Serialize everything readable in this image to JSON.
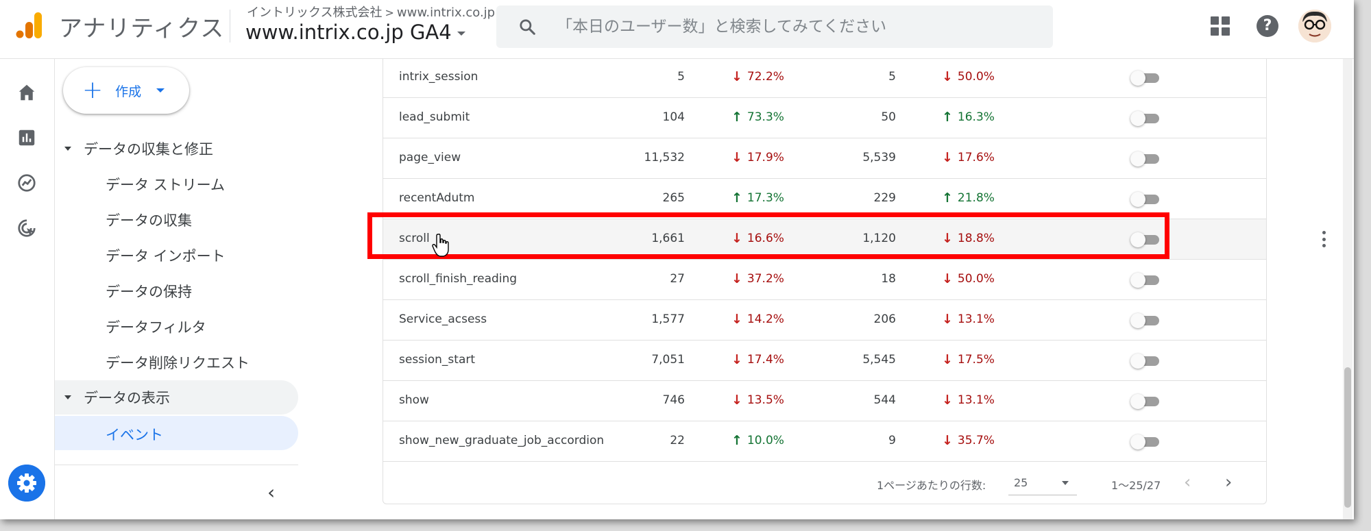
{
  "header": {
    "app_name": "アナリティクス",
    "account_name": "イントリックス株式会社",
    "account_url": "www.intrix.co.jp",
    "property_name": "www.intrix.co.jp GA4",
    "search_placeholder": "「本日のユーザー数」と検索してみてください",
    "logo_colors": [
      "#f9ab00",
      "#e37400"
    ],
    "icons": [
      "analytics-logo-icon",
      "search-icon",
      "apps-grid-icon",
      "help-icon",
      "avatar"
    ]
  },
  "rail": {
    "icons": [
      "home-icon",
      "reports-icon",
      "explore-icon",
      "advertising-icon",
      "settings-icon"
    ],
    "accent": "#1a73e8"
  },
  "nav": {
    "create_label": "作成",
    "sections": [
      {
        "label": "データの収集と修正",
        "items": [
          "データ ストリーム",
          "データの収集",
          "データ インポート",
          "データの保持",
          "データフィルタ",
          "データ削除リクエスト"
        ]
      },
      {
        "label": "データの表示",
        "items": [
          "イベント"
        ]
      }
    ],
    "active_item": "イベント"
  },
  "table": {
    "rows": [
      {
        "name": "intrix_session",
        "count": "5",
        "count_change": "72.2%",
        "count_dir": "down",
        "users": "5",
        "users_change": "50.0%",
        "users_dir": "down",
        "conversion": false
      },
      {
        "name": "lead_submit",
        "count": "104",
        "count_change": "73.3%",
        "count_dir": "up",
        "users": "50",
        "users_change": "16.3%",
        "users_dir": "up",
        "conversion": false
      },
      {
        "name": "page_view",
        "count": "11,532",
        "count_change": "17.9%",
        "count_dir": "down",
        "users": "5,539",
        "users_change": "17.6%",
        "users_dir": "down",
        "conversion": false
      },
      {
        "name": "recentAdutm",
        "count": "265",
        "count_change": "17.3%",
        "count_dir": "up",
        "users": "229",
        "users_change": "21.8%",
        "users_dir": "up",
        "conversion": false
      },
      {
        "name": "scroll",
        "count": "1,661",
        "count_change": "16.6%",
        "count_dir": "down",
        "users": "1,120",
        "users_change": "18.8%",
        "users_dir": "down",
        "conversion": false
      },
      {
        "name": "scroll_finish_reading",
        "count": "27",
        "count_change": "37.2%",
        "count_dir": "down",
        "users": "18",
        "users_change": "50.0%",
        "users_dir": "down",
        "conversion": false
      },
      {
        "name": "Service_acsess",
        "count": "1,577",
        "count_change": "14.2%",
        "count_dir": "down",
        "users": "206",
        "users_change": "13.1%",
        "users_dir": "down",
        "conversion": false
      },
      {
        "name": "session_start",
        "count": "7,051",
        "count_change": "17.4%",
        "count_dir": "down",
        "users": "5,545",
        "users_change": "17.5%",
        "users_dir": "down",
        "conversion": false
      },
      {
        "name": "show",
        "count": "746",
        "count_change": "13.5%",
        "count_dir": "down",
        "users": "544",
        "users_change": "13.1%",
        "users_dir": "down",
        "conversion": false
      },
      {
        "name": "show_new_graduate_job_accordion",
        "count": "22",
        "count_change": "10.0%",
        "count_dir": "up",
        "users": "9",
        "users_change": "35.7%",
        "users_dir": "down",
        "conversion": false
      }
    ],
    "highlighted_row": "scroll",
    "pagination": {
      "rows_per_page_label": "1ページあたりの行数:",
      "rows_per_page": "25",
      "range": "1〜25/27"
    }
  },
  "colors": {
    "decrease": "#c5221f",
    "increase": "#137333",
    "highlight": "#ff0000",
    "accent": "#1a73e8"
  }
}
